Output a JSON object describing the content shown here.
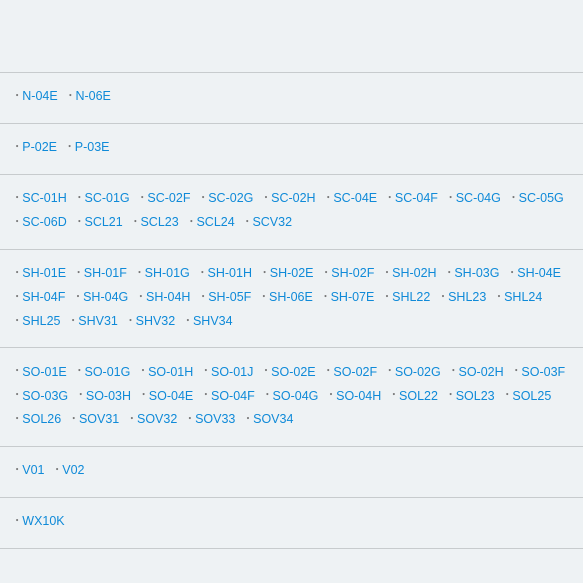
{
  "bullet": "･",
  "groups": [
    {
      "items": [
        "N-04E",
        "N-06E"
      ]
    },
    {
      "items": [
        "P-02E",
        "P-03E"
      ]
    },
    {
      "items": [
        "SC-01H",
        "SC-01G",
        "SC-02F",
        "SC-02G",
        "SC-02H",
        "SC-04E",
        "SC-04F",
        "SC-04G",
        "SC-05G",
        "SC-06D",
        "SCL21",
        "SCL23",
        "SCL24",
        "SCV32"
      ]
    },
    {
      "items": [
        "SH-01E",
        "SH-01F",
        "SH-01G",
        "SH-01H",
        "SH-02E",
        "SH-02F",
        "SH-02H",
        "SH-03G",
        "SH-04E",
        "SH-04F",
        "SH-04G",
        "SH-04H",
        "SH-05F",
        "SH-06E",
        "SH-07E",
        "SHL22",
        "SHL23",
        "SHL24",
        "SHL25",
        "SHV31",
        "SHV32",
        "SHV34"
      ]
    },
    {
      "items": [
        "SO-01E",
        "SO-01G",
        "SO-01H",
        "SO-01J",
        "SO-02E",
        "SO-02F",
        "SO-02G",
        "SO-02H",
        "SO-03F",
        "SO-03G",
        "SO-03H",
        "SO-04E",
        "SO-04F",
        "SO-04G",
        "SO-04H",
        "SOL22",
        "SOL23",
        "SOL25",
        "SOL26",
        "SOV31",
        "SOV32",
        "SOV33",
        "SOV34"
      ]
    },
    {
      "items": [
        "V01",
        "V02"
      ]
    },
    {
      "items": [
        "WX10K"
      ]
    }
  ]
}
